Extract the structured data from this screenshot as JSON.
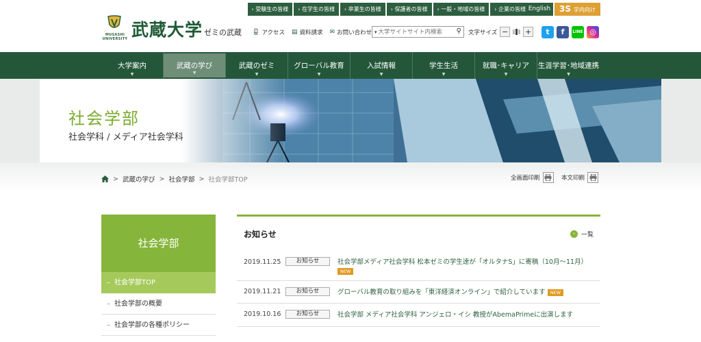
{
  "header": {
    "logo_en": "MUSASHI UNIVERSITY",
    "logo_jp": "武蔵大学",
    "logo_sub": "ゼミの武蔵",
    "topnav": [
      "受験生の皆様",
      "在学生の皆様",
      "卒業生の皆様",
      "保護者の皆様",
      "一般・地域の皆様",
      "企業の皆様"
    ],
    "lang": "English",
    "campus_mark": "3S",
    "campus": "学内向け",
    "util": {
      "access": "アクセス",
      "brochure": "資料請求",
      "contact": "お問い合わせ"
    },
    "search": {
      "scope": "▾",
      "placeholder": "大学サイトサイト内検索"
    },
    "font_size_label": "文字サイズ",
    "font_minus": "−",
    "font_plus": "+"
  },
  "gnav": [
    "大学案内",
    "武蔵の学び",
    "武蔵のゼミ",
    "グローバル教育",
    "入試情報",
    "学生生活",
    "就職･キャリア",
    "生涯学習･地域連携"
  ],
  "hero": {
    "title": "社会学部",
    "subtitle": "社会学科 / メディア社会学科"
  },
  "breadcrumb": {
    "items": [
      "武蔵の学び",
      "社会学部"
    ],
    "current": "社会学部TOP",
    "sep": ">"
  },
  "print": {
    "full": "全画面印刷",
    "body": "本文印刷"
  },
  "side": {
    "title": "社会学部",
    "dash": "–",
    "items": [
      "社会学部TOP",
      "社会学部の概要",
      "社会学部の各種ポリシー"
    ]
  },
  "news": {
    "title": "お知らせ",
    "more": "一覧",
    "new_label": "NEW",
    "items": [
      {
        "date": "2019.11.25",
        "category": "お知らせ",
        "text": "社会学部メディア社会学科 松本ゼミの学生達が「オルタナS」に寄稿（10月～11月）"
      },
      {
        "date": "2019.11.21",
        "category": "お知らせ",
        "text": "グローバル教育の取り組みを「東洋経済オンライン」で紹介しています"
      },
      {
        "date": "2019.10.16",
        "category": "お知らせ",
        "text": "社会学部 メディア社会学科 アンジェロ・イシ 教授がAbemaPrimeに出演します"
      }
    ]
  },
  "colors": {
    "brand_green": "#24573a",
    "accent_green": "#86b53b",
    "campus_orange": "#dda033",
    "new_orange": "#e09a22"
  }
}
